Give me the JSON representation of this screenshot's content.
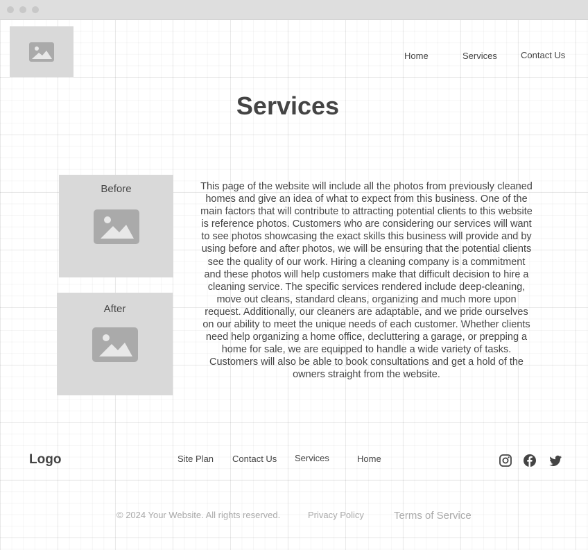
{
  "nav": {
    "logo_icon": "image-placeholder-icon",
    "items": [
      {
        "label": "Home"
      },
      {
        "label": "Services"
      },
      {
        "label": "Contact Us"
      }
    ]
  },
  "page": {
    "title": "Services"
  },
  "gallery": {
    "before_label": "Before",
    "after_label": "After",
    "icon": "image-placeholder-icon"
  },
  "content": {
    "description": "This page of the website will include all the photos from previously cleaned homes and give an idea of what to expect from this business. One of the main factors that will contribute to attracting potential clients to this website is reference photos. Customers who are considering our services will want to see photos showcasing the exact skills this business will provide and by using before and after photos, we will be ensuring that the potential clients see the quality of our work. Hiring a cleaning company is a commitment and these photos will help customers make that difficult decision to hire a cleaning service. The specific services rendered include deep-cleaning, move out cleans, standard cleans, organizing and much more upon request. Additionally, our cleaners are adaptable, and we pride ourselves on our ability to meet the unique needs of each customer. Whether clients need help organizing a home office, decluttering a garage, or prepping a home for sale, we are equipped to handle a wide variety of tasks. Customers will also be able to book consultations and get a hold of the owners straight from the website."
  },
  "footer": {
    "logo": "Logo",
    "links": [
      {
        "label": "Site Plan"
      },
      {
        "label": "Contact Us"
      },
      {
        "label": "Services"
      },
      {
        "label": "Home"
      }
    ],
    "social": [
      "instagram-icon",
      "facebook-icon",
      "twitter-icon"
    ],
    "copyright": "© 2024 Your Website. All rights reserved.",
    "privacy": "Privacy Policy",
    "terms": "Terms of Service"
  },
  "colors": {
    "placeholder": "#d9d9d9",
    "text": "#444444",
    "muted": "#aaaaaa"
  }
}
